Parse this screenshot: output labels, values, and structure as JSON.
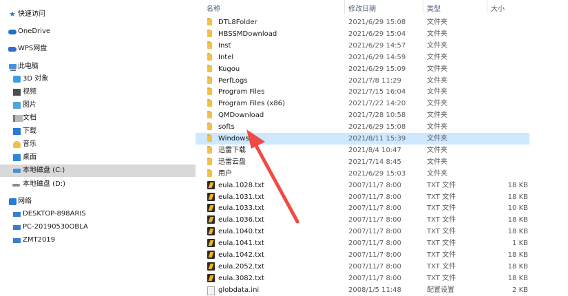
{
  "sidebar": {
    "quick_access": "快速访问",
    "onedrive": "OneDrive",
    "wps": "WPS网盘",
    "this_pc": "此电脑",
    "objects_3d": "3D 对象",
    "videos": "视频",
    "pictures": "图片",
    "documents": "文档",
    "downloads": "下载",
    "music": "音乐",
    "desktop": "桌面",
    "drive_c": "本地磁盘 (C:)",
    "drive_d": "本地磁盘 (D:)",
    "network": "网络",
    "hosts": [
      "DESKTOP-898ARIS",
      "PC-20190530OBLA",
      "ZMT2019"
    ]
  },
  "header": {
    "name": "名称",
    "date": "修改日期",
    "type": "类型",
    "size": "大小"
  },
  "files": [
    {
      "name": "DTL8Folder",
      "date": "2021/6/29 15:08",
      "type": "文件夹",
      "size": "",
      "icon": "folder"
    },
    {
      "name": "HBSSMDownload",
      "date": "2021/6/29 15:04",
      "type": "文件夹",
      "size": "",
      "icon": "folder"
    },
    {
      "name": "Inst",
      "date": "2021/6/29 14:57",
      "type": "文件夹",
      "size": "",
      "icon": "folder"
    },
    {
      "name": "Intel",
      "date": "2021/6/29 14:59",
      "type": "文件夹",
      "size": "",
      "icon": "folder"
    },
    {
      "name": "Kugou",
      "date": "2021/6/29 15:09",
      "type": "文件夹",
      "size": "",
      "icon": "folder"
    },
    {
      "name": "PerfLogs",
      "date": "2021/7/8 11:29",
      "type": "文件夹",
      "size": "",
      "icon": "folder"
    },
    {
      "name": "Program Files",
      "date": "2021/7/15 16:04",
      "type": "文件夹",
      "size": "",
      "icon": "folder"
    },
    {
      "name": "Program Files (x86)",
      "date": "2021/7/22 14:20",
      "type": "文件夹",
      "size": "",
      "icon": "folder"
    },
    {
      "name": "QMDownload",
      "date": "2021/7/28 10:58",
      "type": "文件夹",
      "size": "",
      "icon": "folder"
    },
    {
      "name": "softs",
      "date": "2021/6/29 15:08",
      "type": "文件夹",
      "size": "",
      "icon": "folder"
    },
    {
      "name": "Windows",
      "date": "2021/8/11 15:39",
      "type": "文件夹",
      "size": "",
      "icon": "folder",
      "selected": true
    },
    {
      "name": "迅雷下载",
      "date": "2021/8/4 10:47",
      "type": "文件夹",
      "size": "",
      "icon": "folder"
    },
    {
      "name": "迅雷云盘",
      "date": "2021/7/14 8:45",
      "type": "文件夹",
      "size": "",
      "icon": "folder"
    },
    {
      "name": "用户",
      "date": "2021/6/29 15:03",
      "type": "文件夹",
      "size": "",
      "icon": "folder"
    },
    {
      "name": "eula.1028.txt",
      "date": "2007/11/7 8:00",
      "type": "TXT 文件",
      "size": "18 KB",
      "icon": "txt"
    },
    {
      "name": "eula.1031.txt",
      "date": "2007/11/7 8:00",
      "type": "TXT 文件",
      "size": "18 KB",
      "icon": "txt"
    },
    {
      "name": "eula.1033.txt",
      "date": "2007/11/7 8:00",
      "type": "TXT 文件",
      "size": "10 KB",
      "icon": "txt"
    },
    {
      "name": "eula.1036.txt",
      "date": "2007/11/7 8:00",
      "type": "TXT 文件",
      "size": "18 KB",
      "icon": "txt"
    },
    {
      "name": "eula.1040.txt",
      "date": "2007/11/7 8:00",
      "type": "TXT 文件",
      "size": "18 KB",
      "icon": "txt"
    },
    {
      "name": "eula.1041.txt",
      "date": "2007/11/7 8:00",
      "type": "TXT 文件",
      "size": "1 KB",
      "icon": "txt"
    },
    {
      "name": "eula.1042.txt",
      "date": "2007/11/7 8:00",
      "type": "TXT 文件",
      "size": "18 KB",
      "icon": "txt"
    },
    {
      "name": "eula.2052.txt",
      "date": "2007/11/7 8:00",
      "type": "TXT 文件",
      "size": "18 KB",
      "icon": "txt"
    },
    {
      "name": "eula.3082.txt",
      "date": "2007/11/7 8:00",
      "type": "TXT 文件",
      "size": "18 KB",
      "icon": "txt"
    },
    {
      "name": "globdata.ini",
      "date": "2008/1/5 11:48",
      "type": "配置设置",
      "size": "2 KB",
      "icon": "ini"
    }
  ],
  "colors": {
    "selection": "#cde8ff",
    "sidebar_selected": "#d9d9d9",
    "arrow": "#f04a45"
  }
}
